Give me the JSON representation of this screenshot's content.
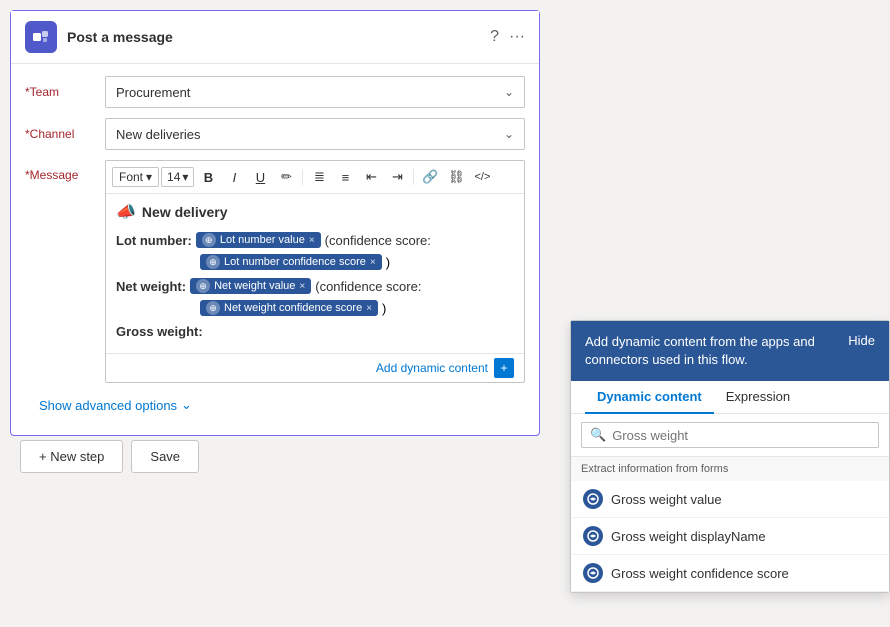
{
  "header": {
    "title": "Post a message",
    "help_icon": "?",
    "more_icon": "···"
  },
  "teams_logo": "T",
  "form": {
    "team_label": "*Team",
    "team_value": "Procurement",
    "channel_label": "*Channel",
    "channel_value": "New deliveries",
    "message_label": "*Message"
  },
  "toolbar": {
    "font_label": "Font",
    "font_arrow": "▾",
    "size_label": "14",
    "size_arrow": "▾",
    "bold": "B",
    "italic": "I",
    "underline": "U",
    "pen": "✏",
    "bullet_list": "≡",
    "numbered_list": "≡",
    "decrease_indent": "⇤",
    "increase_indent": "⇥",
    "link": "🔗",
    "unlink": "⛓",
    "code": "</>"
  },
  "message_content": {
    "delivery_title": "New delivery",
    "lot_number_label": "Lot number:",
    "lot_value_token": "Lot number value",
    "confidence_label": "(confidence score:",
    "lot_confidence_token": "Lot number confidence score",
    "close_paren": ")",
    "net_weight_label": "Net weight:",
    "net_weight_token": "Net weight value",
    "net_confidence_token": "Net weight confidence score",
    "gross_weight_label": "Gross weight:"
  },
  "add_dynamic": "Add dynamic content",
  "advanced_options": "Show advanced options",
  "buttons": {
    "new_step": "+ New step",
    "save": "Save"
  },
  "dynamic_panel": {
    "header_text": "Add dynamic content from the apps and connectors used in this flow.",
    "hide_label": "Hide",
    "tabs": [
      "Dynamic content",
      "Expression"
    ],
    "active_tab": 0,
    "search_placeholder": "Gross weight",
    "section_label": "Extract information from forms",
    "items": [
      {
        "label": "Gross weight value"
      },
      {
        "label": "Gross weight displayName"
      },
      {
        "label": "Gross weight confidence score"
      }
    ]
  }
}
